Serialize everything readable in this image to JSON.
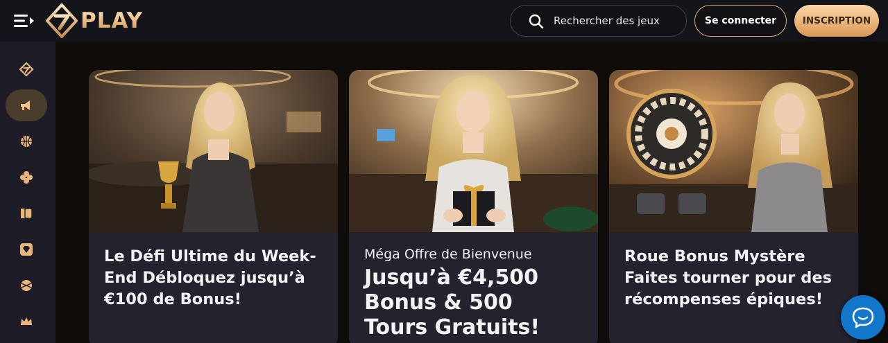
{
  "header": {
    "logo_text": "PLAY",
    "search_label": "Rechercher des jeux",
    "login_label": "Se connecter",
    "signup_label": "INSCRIPTION"
  },
  "sidebar": {
    "items": [
      {
        "icon": "home-icon",
        "active": false
      },
      {
        "icon": "megaphone-icon",
        "active": true
      },
      {
        "icon": "basketball-icon",
        "active": false
      },
      {
        "icon": "clover-icon",
        "active": false
      },
      {
        "icon": "cards-icon",
        "active": false
      },
      {
        "icon": "diamond-icon",
        "active": false
      },
      {
        "icon": "sport-ball-icon",
        "active": false
      },
      {
        "icon": "crown-icon",
        "active": false
      }
    ]
  },
  "promos": [
    {
      "title": "Le Défi Ultime du Week-End Débloquez jusqu’à €100 de Bonus!"
    },
    {
      "subtitle": "Méga Offre de Bienvenue",
      "title": "Jusqu’à €4,500 Bonus & 500 Tours Gratuits!"
    },
    {
      "title": "Roue Bonus Mystère Faites tourner pour des récompenses épiques!"
    }
  ],
  "colors": {
    "accent_gold": "#e8b57c",
    "header_bg": "#14141b",
    "sidebar_bg": "#1e1d27",
    "card_bg": "#24222d",
    "chat_blue": "#1276c9"
  }
}
